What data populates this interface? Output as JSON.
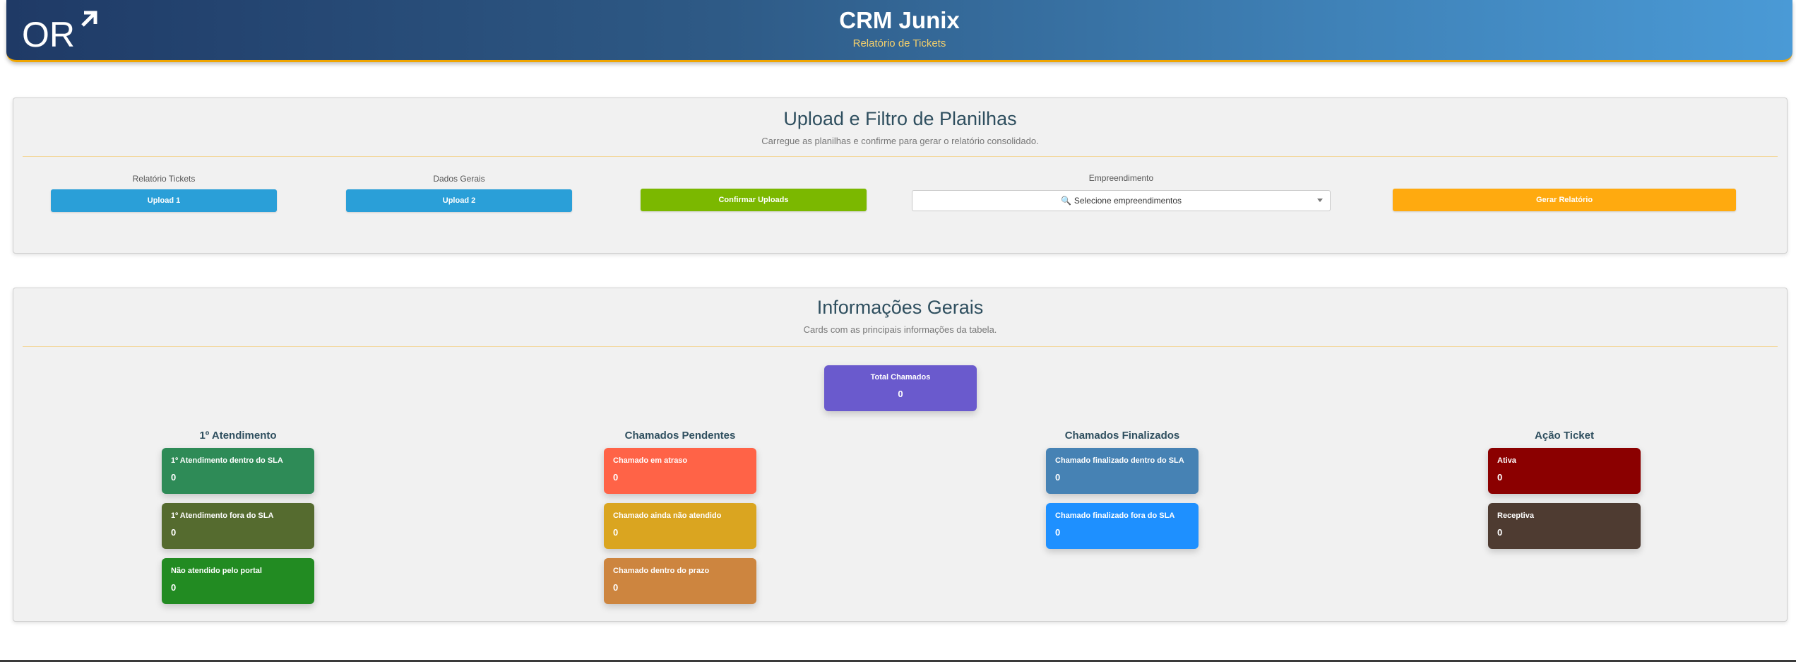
{
  "header": {
    "logo_text": "OR",
    "title": "CRM Junix",
    "subtitle": "Relatório de Tickets"
  },
  "upload": {
    "title": "Upload e Filtro de Planilhas",
    "subtitle": "Carregue as planilhas e confirme para gerar o relatório consolidado.",
    "relatorio_label": "Relatório Tickets",
    "upload1": "Upload 1",
    "dados_label": "Dados Gerais",
    "upload2": "Upload 2",
    "confirm": "Confirmar Uploads",
    "empreendimento_label": "Empreendimento",
    "select_placeholder": "Selecione empreendimentos",
    "generate": "Gerar Relatório"
  },
  "info": {
    "title": "Informações Gerais",
    "subtitle": "Cards com as principais informações da tabela.",
    "total": {
      "label": "Total Chamados",
      "value": "0",
      "color": "#6a5acd"
    },
    "groups": [
      {
        "title": "1º Atendimento",
        "cards": [
          {
            "label": "1º Atendimento dentro do SLA",
            "value": "0",
            "color": "#2e8b57"
          },
          {
            "label": "1º Atendimento fora do SLA",
            "value": "0",
            "color": "#556b2f"
          },
          {
            "label": "Não atendido pelo portal",
            "value": "0",
            "color": "#228b22"
          }
        ]
      },
      {
        "title": "Chamados Pendentes",
        "cards": [
          {
            "label": "Chamado em atraso",
            "value": "0",
            "color": "#ff6347"
          },
          {
            "label": "Chamado ainda não atendido",
            "value": "0",
            "color": "#daa520"
          },
          {
            "label": "Chamado dentro do prazo",
            "value": "0",
            "color": "#cd853f"
          }
        ]
      },
      {
        "title": "Chamados Finalizados",
        "cards": [
          {
            "label": "Chamado finalizado dentro do SLA",
            "value": "0",
            "color": "#4682b4"
          },
          {
            "label": "Chamado finalizado fora do SLA",
            "value": "0",
            "color": "#1e90ff"
          }
        ]
      },
      {
        "title": "Ação Ticket",
        "cards": [
          {
            "label": "Ativa",
            "value": "0",
            "color": "#8b0000"
          },
          {
            "label": "Receptiva",
            "value": "0",
            "color": "#4e3b31"
          }
        ]
      }
    ]
  }
}
